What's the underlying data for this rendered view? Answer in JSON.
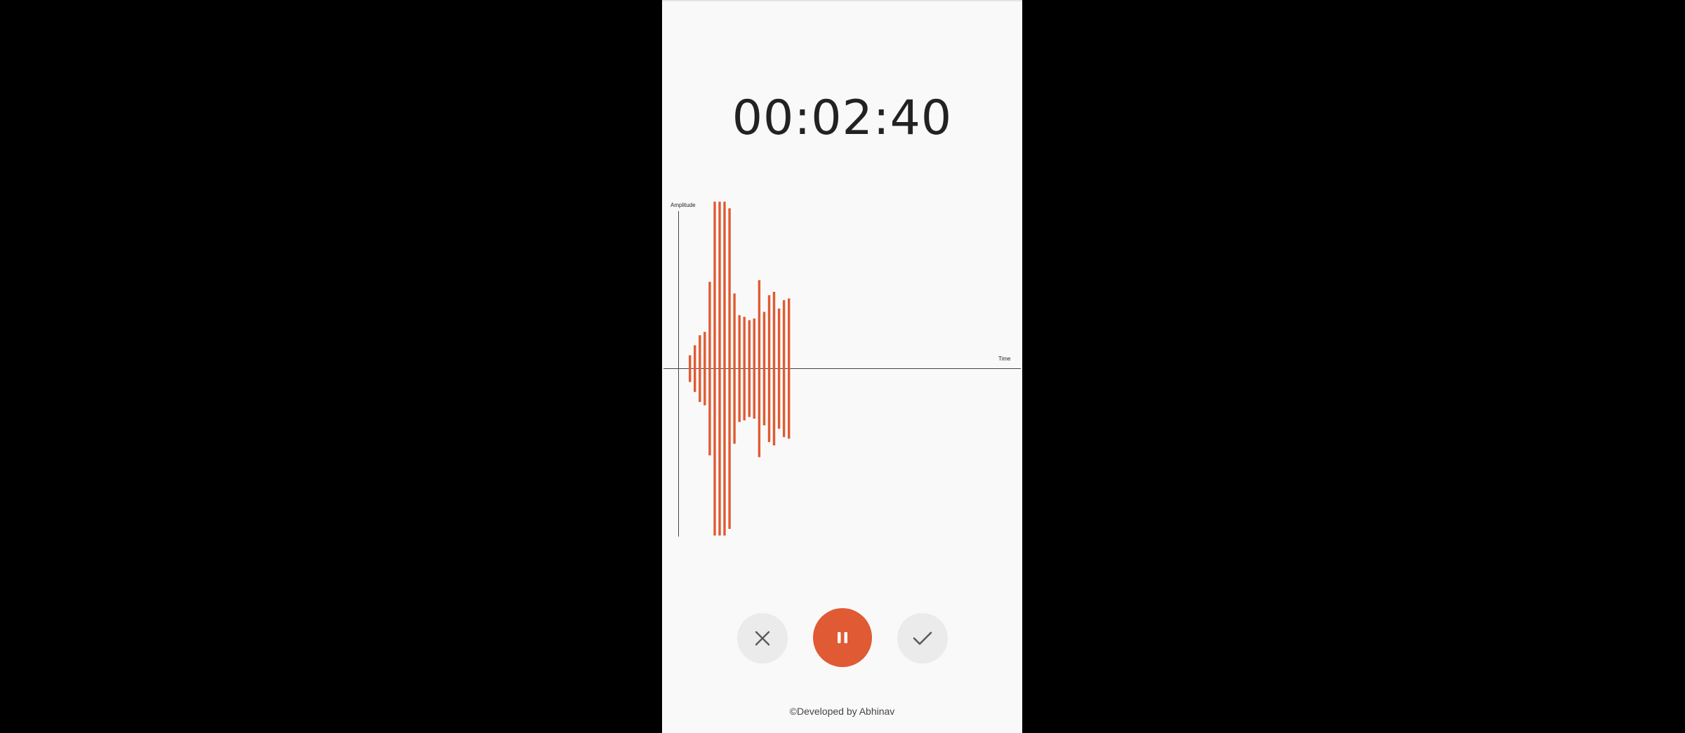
{
  "recorder": {
    "timer": "00:02:40"
  },
  "chart_data": {
    "type": "bar",
    "xlabel": "Time",
    "ylabel": "Amplitude",
    "ylim": [
      -1,
      1
    ],
    "bar_color": "#e05a33",
    "values": [
      0.08,
      0.14,
      0.2,
      0.22,
      0.52,
      1.0,
      1.0,
      1.0,
      0.96,
      0.45,
      0.32,
      0.31,
      0.29,
      0.3,
      0.53,
      0.34,
      0.44,
      0.46,
      0.36,
      0.41,
      0.42
    ]
  },
  "controls": {
    "cancel_icon": "close-icon",
    "pause_icon": "pause-icon",
    "done_icon": "check-icon",
    "accent_color": "#e05a33"
  },
  "footer": {
    "credit": "©Developed by Abhinav"
  }
}
